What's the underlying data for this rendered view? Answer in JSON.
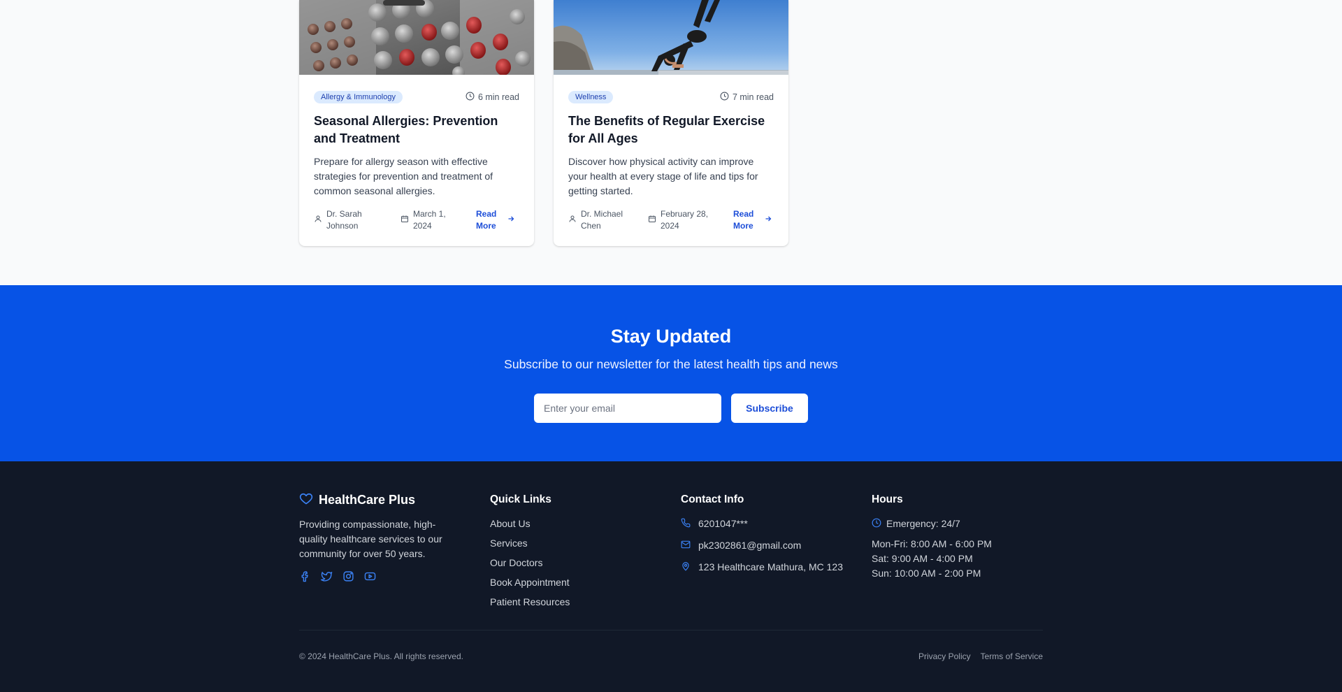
{
  "articles": [
    {
      "category": "Allergy & Immunology",
      "read_time": "6 min read",
      "title": "Seasonal Allergies: Prevention and Treatment",
      "excerpt": "Prepare for allergy season with effective strategies for prevention and treatment of common seasonal allergies.",
      "author": "Dr. Sarah Johnson",
      "date": "March 1, 2024",
      "cta": "Read More",
      "image": "medication-pills-photo"
    },
    {
      "category": "Wellness",
      "read_time": "7 min read",
      "title": "The Benefits of Regular Exercise for All Ages",
      "excerpt": "Discover how physical activity can improve your health at every stage of life and tips for getting started.",
      "author": "Dr. Michael Chen",
      "date": "February 28, 2024",
      "cta": "Read More",
      "image": "yoga-pose-photo"
    }
  ],
  "newsletter": {
    "title": "Stay Updated",
    "subtitle": "Subscribe to our newsletter for the latest health tips and news",
    "email_placeholder": "Enter your email",
    "button_label": "Subscribe",
    "background": "#0753e6"
  },
  "footer": {
    "brand": "HealthCare Plus",
    "description": "Providing compassionate, high-quality healthcare services to our community for over 50 years.",
    "social_icons": [
      "facebook-icon",
      "twitter-icon",
      "instagram-icon",
      "youtube-icon"
    ],
    "quick_links": {
      "heading": "Quick Links",
      "items": [
        "About Us",
        "Services",
        "Our Doctors",
        "Book Appointment",
        "Patient Resources"
      ]
    },
    "contact": {
      "heading": "Contact Info",
      "phone": "6201047***",
      "email": "pk2302861@gmail.com",
      "address": "123 Healthcare Mathura, MC 123"
    },
    "hours": {
      "heading": "Hours",
      "emergency": "Emergency: 24/7",
      "weekdays": "Mon-Fri: 8:00 AM - 6:00 PM",
      "saturday": "Sat: 9:00 AM - 4:00 PM",
      "sunday": "Sun: 10:00 AM - 2:00 PM"
    },
    "copyright": "© 2024 HealthCare Plus. All rights reserved.",
    "legal": [
      "Privacy Policy",
      "Terms of Service"
    ],
    "background": "#111827",
    "accent": "#3b82f6"
  }
}
